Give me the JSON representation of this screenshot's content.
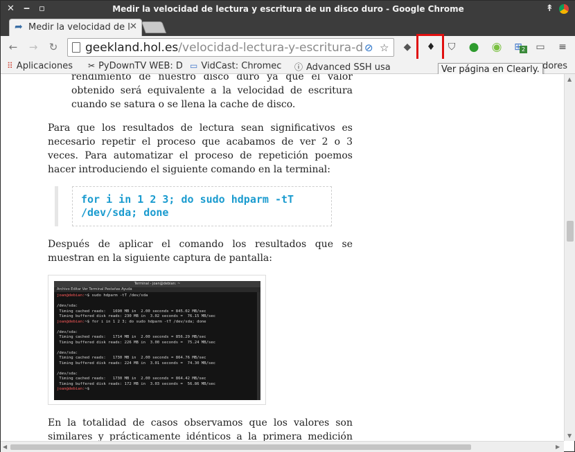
{
  "window": {
    "title": "Medir la velocidad de lectura y escritura de un disco duro - Google Chrome"
  },
  "tab": {
    "title": "Medir la velocidad de lectura y escritura de un disco duro"
  },
  "omnibox": {
    "host": "geekland.hol.es",
    "path": "/velocidad-lectura-y-escritura-disco-duro/"
  },
  "bookmarks": [
    {
      "label": "Aplicaciones",
      "icon": "apps-grid-icon"
    },
    {
      "label": "PyDownTV WEB: D",
      "icon": "pydowntv-icon"
    },
    {
      "label": "VidCast: Chromec",
      "icon": "cast-icon"
    },
    {
      "label": "Advanced SSH usa",
      "icon": "info-icon"
    }
  ],
  "bookmarks_trailing": "adores",
  "tooltip": "Ver página en Clearly.",
  "article": {
    "list_item_tail": "rendimiento de nuestro disco duro ya que el valor obtenido será equivalente a la velocidad de escritura cuando se satura o se llena la cache de disco.",
    "para1": "Para que los resultados de lectura sean significativos es necesario repetir el proceso que acabamos de ver 2 o 3 veces. Para automatizar el proceso de repetición poemos hacer introduciendo el siguiente comando en la terminal:",
    "code": "for i in 1 2 3; do sudo hdparm -tT /dev/sda; done",
    "para2": "Después de aplicar el comando los resultados que se muestran en la siguiente captura de pantalla:",
    "para3": "En la totalidad de casos observamos que los valores son similares y prácticamente idénticos a la primera medición que realizamos."
  },
  "terminal": {
    "title": "Terminal - joan@debian: ~",
    "menu": "Archivo   Editar   Ver   Terminal   Pestañas   Ayuda",
    "lines": [
      {
        "prompt": "joan@debian:",
        "text": "~$ sudo hdparm -tT /dev/sda"
      },
      {
        "prompt": "",
        "text": ""
      },
      {
        "prompt": "",
        "text": "/dev/sda:"
      },
      {
        "prompt": "",
        "text": " Timing cached reads:   1690 MB in  2.00 seconds = 845.02 MB/sec"
      },
      {
        "prompt": "",
        "text": " Timing buffered disk reads: 230 MB in  3.02 seconds =  76.15 MB/sec"
      },
      {
        "prompt": "joan@debian:",
        "text": "~$ for i in 1 2 3; do sudo hdparm -tT /dev/sda; done"
      },
      {
        "prompt": "",
        "text": ""
      },
      {
        "prompt": "",
        "text": "/dev/sda:"
      },
      {
        "prompt": "",
        "text": " Timing cached reads:   1714 MB in  2.00 seconds = 856.29 MB/sec"
      },
      {
        "prompt": "",
        "text": " Timing buffered disk reads: 226 MB in  3.00 seconds =  75.24 MB/sec"
      },
      {
        "prompt": "",
        "text": ""
      },
      {
        "prompt": "",
        "text": "/dev/sda:"
      },
      {
        "prompt": "",
        "text": " Timing cached reads:   1730 MB in  2.00 seconds = 864.76 MB/sec"
      },
      {
        "prompt": "",
        "text": " Timing buffered disk reads: 224 MB in  3.01 seconds =  74.30 MB/sec"
      },
      {
        "prompt": "",
        "text": ""
      },
      {
        "prompt": "",
        "text": "/dev/sda:"
      },
      {
        "prompt": "",
        "text": " Timing cached reads:   1730 MB in  2.00 seconds = 864.42 MB/sec"
      },
      {
        "prompt": "",
        "text": " Timing buffered disk reads: 172 MB in  3.03 seconds =  56.86 MB/sec"
      },
      {
        "prompt": "joan@debian:",
        "text": "~$ "
      }
    ]
  },
  "extensions": {
    "badge_count": "2"
  },
  "colors": {
    "highlight_box": "#e01010",
    "code_text": "#1a9bcf",
    "titlebar": "#3c3c3c"
  }
}
